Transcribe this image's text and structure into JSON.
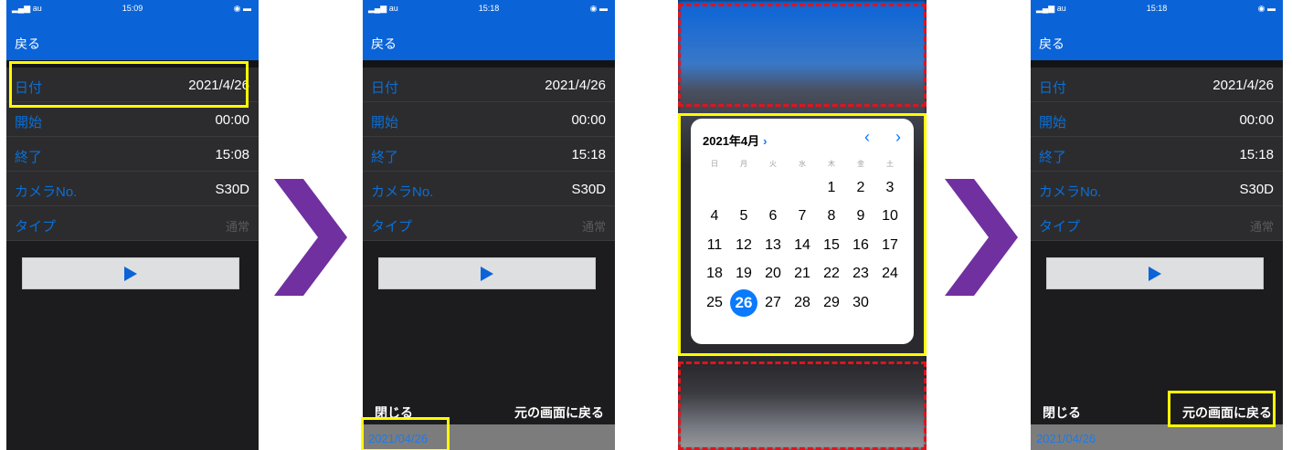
{
  "status": {
    "carrier": "au",
    "time1": "15:09",
    "time2": "15:18",
    "time3": "15:18",
    "time4": "15:18"
  },
  "nav": {
    "back": "戻る"
  },
  "form": {
    "date_label": "日付",
    "start_label": "開始",
    "end_label": "終了",
    "camera_label": "カメラNo.",
    "type_label": "タイプ",
    "date_value": "2021/4/26",
    "start_value": "00:00",
    "end_value1": "15:08",
    "end_value2": "15:18",
    "camera_value": "S30D",
    "type_value": "通常"
  },
  "toolbar": {
    "close": "閉じる",
    "return_original": "元の画面に戻る"
  },
  "date_field": {
    "value": "2021/04/26"
  },
  "calendar": {
    "month_title": "2021年4月",
    "weekdays": [
      "日",
      "月",
      "火",
      "水",
      "木",
      "金",
      "土"
    ],
    "weeks": [
      [
        "",
        "",
        "",
        "",
        "1",
        "2",
        "3"
      ],
      [
        "4",
        "5",
        "6",
        "7",
        "8",
        "9",
        "10"
      ],
      [
        "11",
        "12",
        "13",
        "14",
        "15",
        "16",
        "17"
      ],
      [
        "18",
        "19",
        "20",
        "21",
        "22",
        "23",
        "24"
      ],
      [
        "25",
        "26",
        "27",
        "28",
        "29",
        "30",
        ""
      ]
    ],
    "selected_day": "26"
  },
  "colors": {
    "accent": "#0a64d8",
    "highlight": "#ffff00",
    "dashed": "#e0141e",
    "arrow": "#7030a0"
  }
}
